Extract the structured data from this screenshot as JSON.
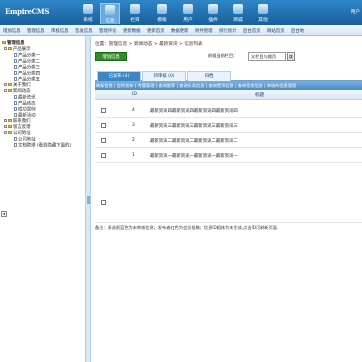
{
  "app": {
    "logo": "EmpireCMS",
    "user": "用户"
  },
  "topnav": [
    {
      "label": "系统",
      "icon": "system-icon"
    },
    {
      "label": "信息",
      "icon": "info-icon"
    },
    {
      "label": "栏目",
      "icon": "column-icon"
    },
    {
      "label": "模板",
      "icon": "template-icon"
    },
    {
      "label": "用户",
      "icon": "user-icon"
    },
    {
      "label": "插件",
      "icon": "plugin-icon"
    },
    {
      "label": "商城",
      "icon": "shop-icon"
    },
    {
      "label": "其他",
      "icon": "other-icon"
    }
  ],
  "menubar": [
    "增加信息",
    "管理信息",
    "审核信息",
    "签发信息",
    "管理评论",
    "更新数据",
    "更新首页",
    "数据更新",
    "附件管理",
    "排行统计",
    "后台首页",
    "网站首页",
    "后台地"
  ],
  "sidebar": {
    "root": "管理信息",
    "items": [
      "产品展示",
      "产品分类一",
      "产品分类二",
      "产品分类三",
      "产品分类四",
      "产品分类五",
      "关于我们",
      "新闻动态",
      "最新资讯",
      "产品动态",
      "成功案例",
      "最新活动",
      "联系我们",
      "留言反馈",
      "公司地址",
      "公司地址",
      "文档管理 (看到隐藏下面的)"
    ]
  },
  "main": {
    "breadcrumb": "位置：管理信息 > 新闻动态 > 最新资讯 > 信息列表",
    "add_button": "增加信息",
    "column_select": "前缀当前栏目：",
    "column_value": "父栏目与搜页",
    "jump_button": "跳",
    "tabs": [
      "已发布 (4)",
      "待审核 (0)",
      "归档"
    ],
    "ops_bar": "刷新信息 | 定时发布 | 专题管理 | 查询推荐 | 查询头条信息 | 查询置顶信息 | 查询签发信息 | 审核的信息管理",
    "col_id": "ID",
    "col_title": "标题",
    "rows": [
      {
        "id": "4",
        "title": "最新资讯四最新资讯四最新资讯四最新资讯四"
      },
      {
        "id": "3",
        "title": "最新资讯三最新资讯三最新资讯三最新资讯三"
      },
      {
        "id": "2",
        "title": "最新资讯二最新资讯二最新资讯二最新资讯二"
      },
      {
        "id": "1",
        "title": "最新资讯一最新资讯一最新资讯一最新资讯一"
      }
    ],
    "note": "备注：多选框蓝色为未审核信息；发布者红色为会员投稿；信息ID粗体为未生成,点击ID可刷新页面."
  },
  "colors": {
    "header": "#1a5f9c",
    "accent": "#3c86c6",
    "add_button": "#2f8f29"
  }
}
